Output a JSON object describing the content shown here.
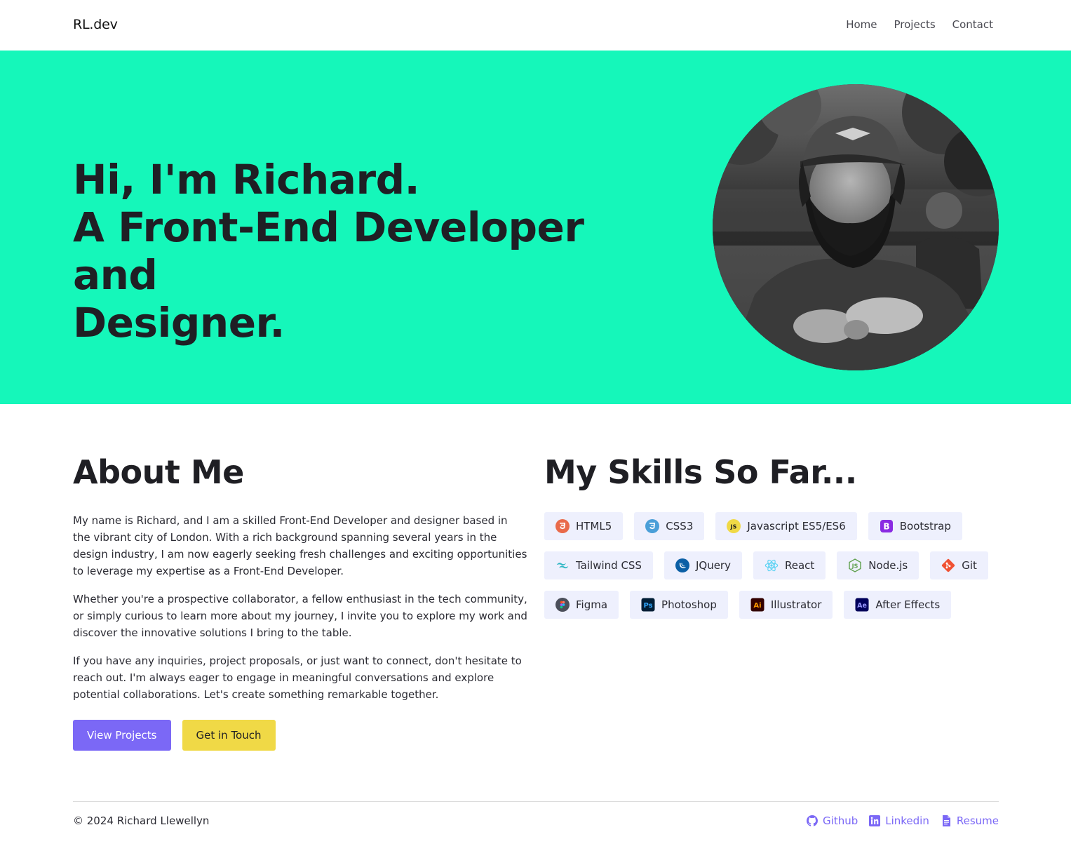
{
  "header": {
    "logo": "RL.dev",
    "nav": [
      "Home",
      "Projects",
      "Contact"
    ]
  },
  "hero": {
    "line1": "Hi, I'm Richard.",
    "line2": "A Front-End Developer and",
    "line3": "Designer.",
    "background": "#15f7ba"
  },
  "about": {
    "heading": "About Me",
    "paragraphs": [
      "My name is Richard, and I am a skilled Front-End Developer and designer based in the vibrant city of London. With a rich background spanning several years in the design industry, I am now eagerly seeking fresh challenges and exciting opportunities to leverage my expertise as a Front-End Developer.",
      "Whether you're a prospective collaborator, a fellow enthusiast in the tech community, or simply curious to learn more about my journey, I invite you to explore my work and discover the innovative solutions I bring to the table.",
      "If you have any inquiries, project proposals, or just want to connect, don't hesitate to reach out. I'm always eager to engage in meaningful conversations and explore potential collaborations. Let's create something remarkable together."
    ],
    "buttons": {
      "primary": "View Projects",
      "secondary": "Get in Touch"
    }
  },
  "skills": {
    "heading": "My Skills So Far...",
    "items": [
      {
        "label": "HTML5",
        "icon": "html5-icon"
      },
      {
        "label": "CSS3",
        "icon": "css3-icon"
      },
      {
        "label": "Javascript ES5/ES6",
        "icon": "javascript-icon"
      },
      {
        "label": "Bootstrap",
        "icon": "bootstrap-icon"
      },
      {
        "label": "Tailwind CSS",
        "icon": "tailwind-icon"
      },
      {
        "label": "JQuery",
        "icon": "jquery-icon"
      },
      {
        "label": "React",
        "icon": "react-icon"
      },
      {
        "label": "Node.js",
        "icon": "nodejs-icon"
      },
      {
        "label": "Git",
        "icon": "git-icon"
      },
      {
        "label": "Figma",
        "icon": "figma-icon"
      },
      {
        "label": "Photoshop",
        "icon": "photoshop-icon"
      },
      {
        "label": "Illustrator",
        "icon": "illustrator-icon"
      },
      {
        "label": "After Effects",
        "icon": "after-effects-icon"
      }
    ]
  },
  "footer": {
    "copyright": "© 2024 Richard Llewellyn",
    "links": [
      {
        "label": "Github",
        "icon": "github-icon"
      },
      {
        "label": "Linkedin",
        "icon": "linkedin-icon"
      },
      {
        "label": "Resume",
        "icon": "document-icon"
      }
    ]
  },
  "colors": {
    "accent": "#7b68f6",
    "yellow": "#f0d946",
    "chip": "#eef0fd"
  }
}
